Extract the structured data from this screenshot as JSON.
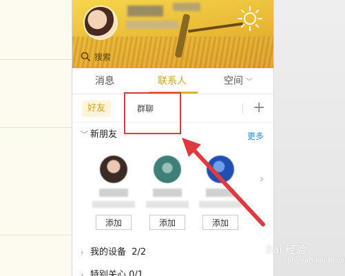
{
  "header": {
    "search_placeholder": "搜索"
  },
  "tabs": [
    {
      "label": "消息",
      "selected": false
    },
    {
      "label": "联系人",
      "selected": true
    },
    {
      "label": "空间",
      "selected": false
    }
  ],
  "subtabs": {
    "friends": "好友",
    "groups": "群聊",
    "add": "+"
  },
  "new_friends": {
    "title": "新朋友",
    "more": "更多",
    "add_labels": [
      "添加",
      "添加",
      "添加"
    ]
  },
  "groups": {
    "my_devices": "我的设备",
    "my_devices_count": "2/2",
    "special_care_partial": "特别关心",
    "special_care_count": "0/1"
  },
  "watermark": {
    "brand": "Bai 经验",
    "sub": "jingyan.baidu.com"
  },
  "colors": {
    "accent": "#e0b42a",
    "annotation": "#e0393e",
    "link": "#2a8ed8"
  }
}
